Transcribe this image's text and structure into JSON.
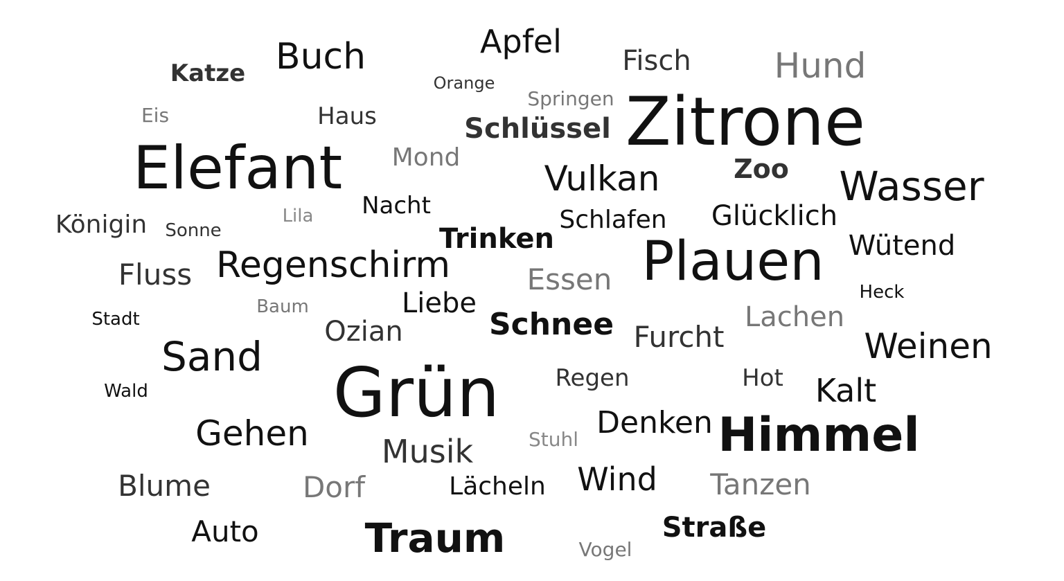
{
  "word_cloud": {
    "words": [
      {
        "text": "Apfel",
        "shade": "#111111",
        "bold": false
      },
      {
        "text": "Buch",
        "shade": "#111111",
        "bold": false
      },
      {
        "text": "Katze",
        "shade": "#333333",
        "bold": true
      },
      {
        "text": "Fisch",
        "shade": "#333333",
        "bold": false
      },
      {
        "text": "Hund",
        "shade": "#777777",
        "bold": false
      },
      {
        "text": "Orange",
        "shade": "#333333",
        "bold": false
      },
      {
        "text": "Springen",
        "shade": "#777777",
        "bold": false
      },
      {
        "text": "Eis",
        "shade": "#777777",
        "bold": false
      },
      {
        "text": "Haus",
        "shade": "#333333",
        "bold": false
      },
      {
        "text": "Schlüssel",
        "shade": "#333333",
        "bold": true
      },
      {
        "text": "Zitrone",
        "shade": "#111111",
        "bold": false
      },
      {
        "text": "Elefant",
        "shade": "#111111",
        "bold": false
      },
      {
        "text": "Mond",
        "shade": "#777777",
        "bold": false
      },
      {
        "text": "Vulkan",
        "shade": "#111111",
        "bold": false
      },
      {
        "text": "Zoo",
        "shade": "#333333",
        "bold": true
      },
      {
        "text": "Wasser",
        "shade": "#111111",
        "bold": false
      },
      {
        "text": "Nacht",
        "shade": "#111111",
        "bold": false
      },
      {
        "text": "Königin",
        "shade": "#333333",
        "bold": false
      },
      {
        "text": "Sonne",
        "shade": "#333333",
        "bold": false
      },
      {
        "text": "Lila",
        "shade": "#888888",
        "bold": false
      },
      {
        "text": "Schlafen",
        "shade": "#111111",
        "bold": false
      },
      {
        "text": "Glücklich",
        "shade": "#111111",
        "bold": false
      },
      {
        "text": "Trinken",
        "shade": "#111111",
        "bold": true
      },
      {
        "text": "Plauen",
        "shade": "#111111",
        "bold": false
      },
      {
        "text": "Wütend",
        "shade": "#111111",
        "bold": false
      },
      {
        "text": "Regenschirm",
        "shade": "#111111",
        "bold": false
      },
      {
        "text": "Fluss",
        "shade": "#333333",
        "bold": false
      },
      {
        "text": "Essen",
        "shade": "#777777",
        "bold": false
      },
      {
        "text": "Heck",
        "shade": "#111111",
        "bold": false
      },
      {
        "text": "Stadt",
        "shade": "#111111",
        "bold": false
      },
      {
        "text": "Baum",
        "shade": "#777777",
        "bold": false
      },
      {
        "text": "Liebe",
        "shade": "#111111",
        "bold": false
      },
      {
        "text": "Schnee",
        "shade": "#111111",
        "bold": true
      },
      {
        "text": "Lachen",
        "shade": "#777777",
        "bold": false
      },
      {
        "text": "Ozian",
        "shade": "#333333",
        "bold": false
      },
      {
        "text": "Furcht",
        "shade": "#333333",
        "bold": false
      },
      {
        "text": "Weinen",
        "shade": "#111111",
        "bold": false
      },
      {
        "text": "Sand",
        "shade": "#111111",
        "bold": false
      },
      {
        "text": "Grün",
        "shade": "#111111",
        "bold": false
      },
      {
        "text": "Regen",
        "shade": "#333333",
        "bold": false
      },
      {
        "text": "Hot",
        "shade": "#333333",
        "bold": false
      },
      {
        "text": "Kalt",
        "shade": "#111111",
        "bold": false
      },
      {
        "text": "Wald",
        "shade": "#111111",
        "bold": false
      },
      {
        "text": "Gehen",
        "shade": "#111111",
        "bold": false
      },
      {
        "text": "Denken",
        "shade": "#111111",
        "bold": false
      },
      {
        "text": "Himmel",
        "shade": "#111111",
        "bold": true
      },
      {
        "text": "Stuhl",
        "shade": "#888888",
        "bold": false
      },
      {
        "text": "Musik",
        "shade": "#333333",
        "bold": false
      },
      {
        "text": "Blume",
        "shade": "#333333",
        "bold": false
      },
      {
        "text": "Dorf",
        "shade": "#777777",
        "bold": false
      },
      {
        "text": "Lächeln",
        "shade": "#111111",
        "bold": false
      },
      {
        "text": "Wind",
        "shade": "#111111",
        "bold": false
      },
      {
        "text": "Tanzen",
        "shade": "#777777",
        "bold": false
      },
      {
        "text": "Auto",
        "shade": "#111111",
        "bold": false
      },
      {
        "text": "Traum",
        "shade": "#111111",
        "bold": true
      },
      {
        "text": "Straße",
        "shade": "#111111",
        "bold": true
      },
      {
        "text": "Vogel",
        "shade": "#777777",
        "bold": false
      }
    ]
  }
}
